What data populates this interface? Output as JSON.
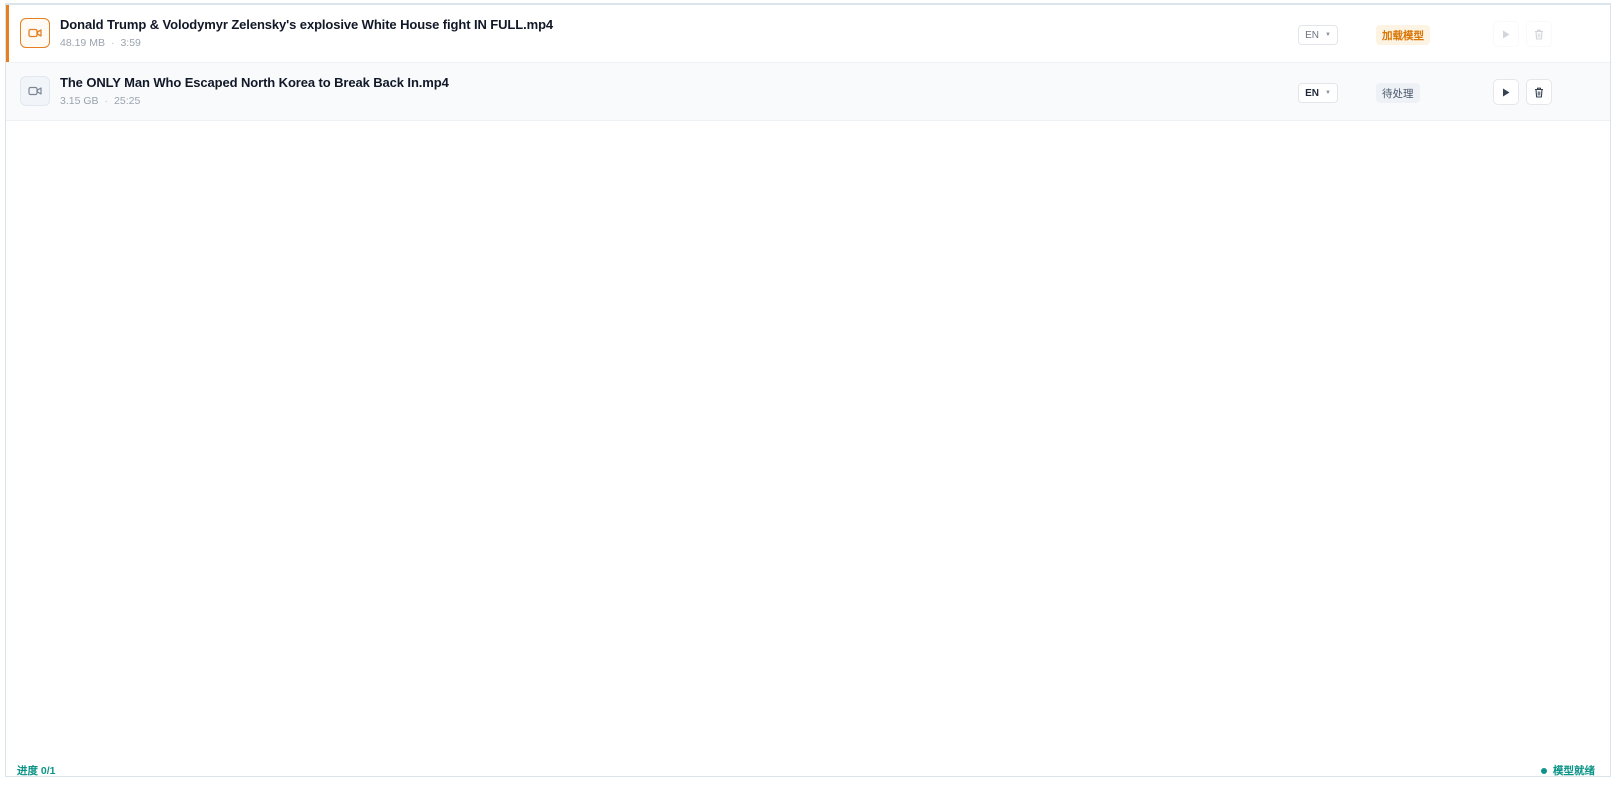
{
  "files": [
    {
      "name": "Donald Trump & Volodymyr Zelensky's explosive White House fight IN FULL.mp4",
      "size": "48.19 MB",
      "separator": "·",
      "duration": "3:59",
      "language": "EN",
      "status": "加载模型",
      "icon": "video-camera-icon"
    },
    {
      "name": "The ONLY Man Who Escaped North Korea to Break Back In.mp4",
      "size": "3.15 GB",
      "separator": "·",
      "duration": "25:25",
      "language": "EN",
      "status": "待处理",
      "icon": "video-camera-icon"
    }
  ],
  "footer": {
    "progress": "进度 0/1",
    "model_status": "模型就绪"
  },
  "colors": {
    "accent": "#e67e22",
    "ready": "#0d9488"
  }
}
